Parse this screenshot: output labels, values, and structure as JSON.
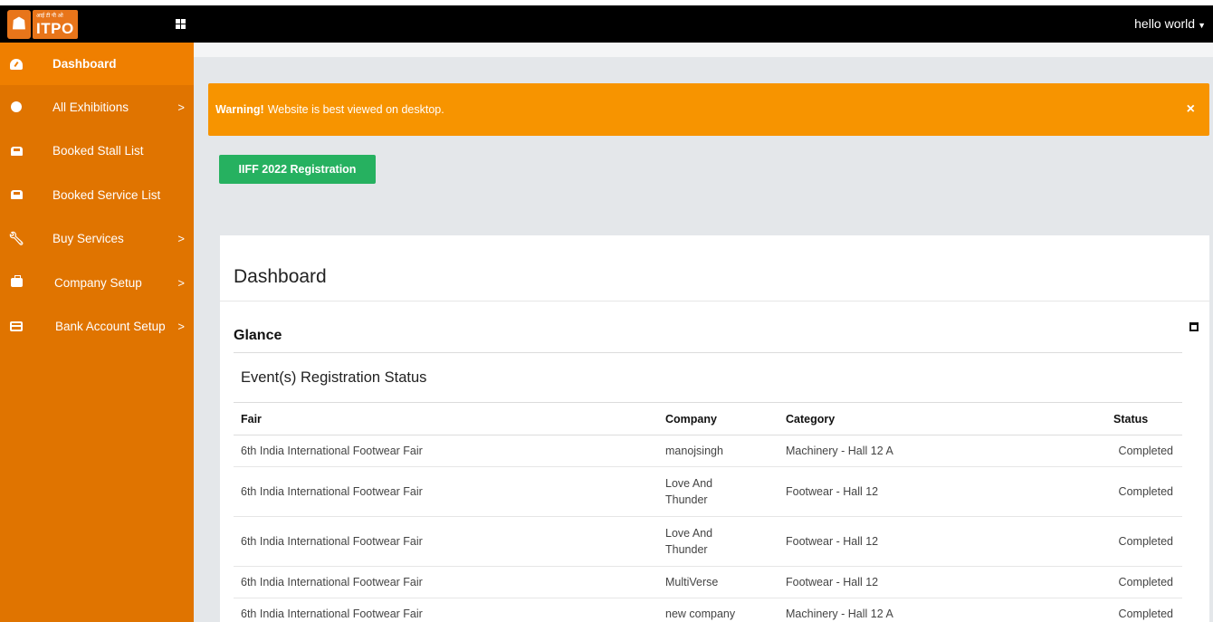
{
  "header": {
    "logo_hindi": "आई टी पी ओ",
    "logo_text": "ITPO",
    "user_name": "hello world"
  },
  "sidebar": {
    "items": [
      {
        "label": "Dashboard",
        "icon": "dashboard-icon",
        "active": true,
        "arrow": ""
      },
      {
        "label": "All Exhibitions",
        "icon": "globe-icon",
        "active": false,
        "arrow": ">"
      },
      {
        "label": "Booked Stall List",
        "icon": "inbox-icon",
        "active": false,
        "arrow": ""
      },
      {
        "label": "Booked Service List",
        "icon": "inbox-icon",
        "active": false,
        "arrow": ""
      },
      {
        "label": "Buy Services",
        "icon": "wrench-icon",
        "active": false,
        "arrow": ">"
      },
      {
        "label": "Company Setup",
        "icon": "briefcase-icon",
        "active": false,
        "arrow": ">"
      },
      {
        "label": "Bank Account Setup",
        "icon": "credit-card-icon",
        "active": false,
        "arrow": ">"
      }
    ]
  },
  "warning": {
    "strong": "Warning!",
    "message": "Website is best viewed on desktop.",
    "close_icon": "×"
  },
  "registration_button": "IIFF 2022 Registration",
  "panel": {
    "title": "Dashboard",
    "glance": "Glance",
    "status_heading": "Event(s) Registration Status"
  },
  "table": {
    "headers": [
      "Fair",
      "Company",
      "Category",
      "Status"
    ],
    "rows": [
      {
        "fair": "6th India International Footwear Fair",
        "company": "manojsingh",
        "category": "Machinery - Hall 12 A",
        "status": "Completed"
      },
      {
        "fair": "6th India International Footwear Fair",
        "company": "Love And Thunder",
        "category": "Footwear - Hall 12",
        "status": "Completed"
      },
      {
        "fair": "6th India International Footwear Fair",
        "company": "Love And Thunder",
        "category": "Footwear - Hall 12",
        "status": "Completed"
      },
      {
        "fair": "6th India International Footwear Fair",
        "company": "MultiVerse",
        "category": "Footwear - Hall 12",
        "status": "Completed"
      },
      {
        "fair": "6th India International Footwear Fair",
        "company": "new company",
        "category": "Machinery - Hall 12 A",
        "status": "Completed"
      }
    ]
  },
  "colors": {
    "sidebar": "#e07400",
    "sidebar_active": "#ef7f00",
    "warning": "#f79400",
    "button": "#26b160",
    "topbar": "#000000"
  }
}
